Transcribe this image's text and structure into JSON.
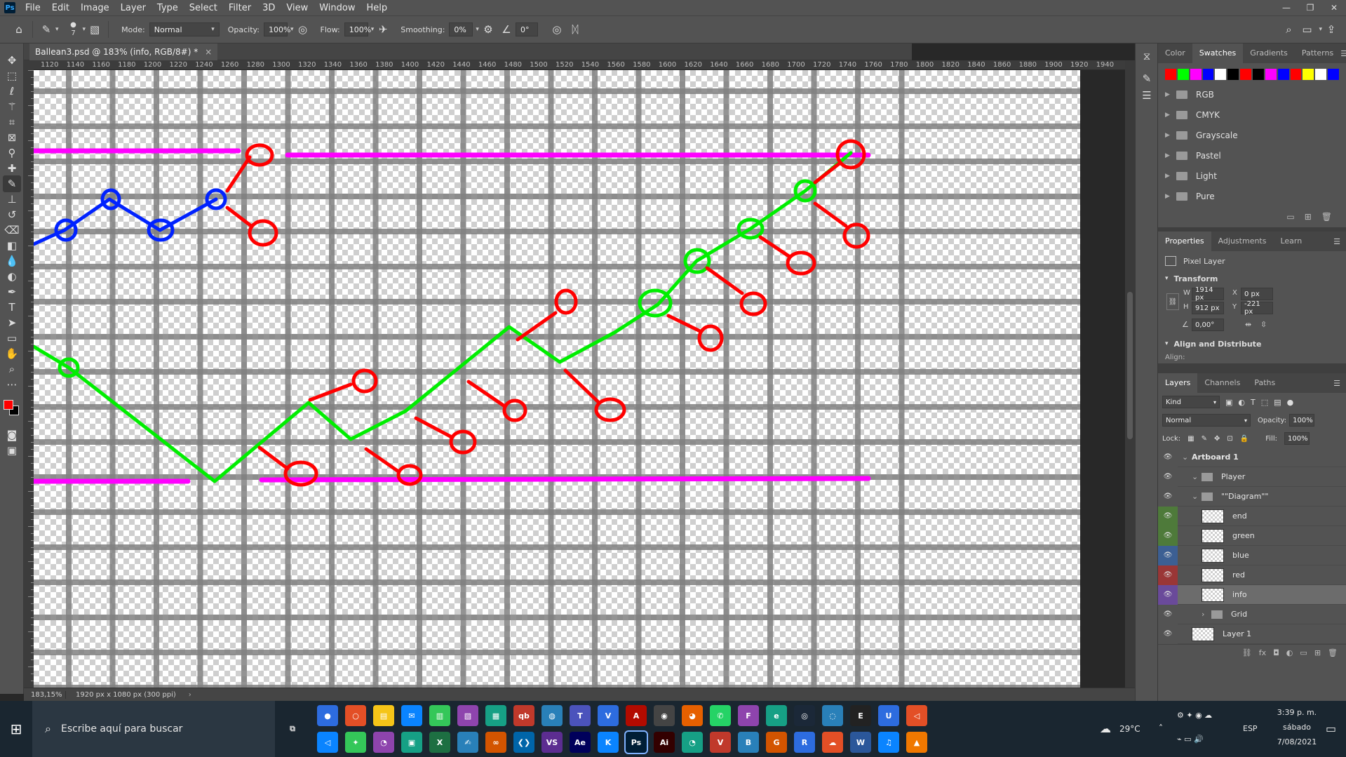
{
  "app": {
    "logo_text": "Ps"
  },
  "menu": [
    "File",
    "Edit",
    "Image",
    "Layer",
    "Type",
    "Select",
    "Filter",
    "3D",
    "View",
    "Window",
    "Help"
  ],
  "options": {
    "brush_size": "7",
    "mode_label": "Mode:",
    "mode_value": "Normal",
    "opacity_label": "Opacity:",
    "opacity_value": "100%",
    "flow_label": "Flow:",
    "flow_value": "100%",
    "smoothing_label": "Smoothing:",
    "smoothing_value": "0%",
    "angle_value": "0°"
  },
  "document": {
    "tab_title": "Ballean3.psd @ 183% (info, RGB/8#) *",
    "close_glyph": "×",
    "zoom": "183,15%",
    "doc_info": "1920 px x 1080 px (300 ppi)"
  },
  "ruler_top_labels": [
    "1120",
    "1140",
    "1160",
    "1180",
    "1200",
    "1220",
    "1240",
    "1260",
    "1280",
    "1300",
    "1320",
    "1340",
    "1360",
    "1380",
    "1400",
    "1420",
    "1440",
    "1460",
    "1480",
    "1500",
    "1520",
    "1540",
    "1560",
    "1580",
    "1600",
    "1620",
    "1640",
    "1660",
    "1680",
    "1700",
    "1720",
    "1740",
    "1760",
    "1780",
    "1800",
    "1820",
    "1840",
    "1860",
    "1880",
    "1900",
    "1920",
    "1940"
  ],
  "swatches_panel": {
    "tabs": [
      "Color",
      "Swatches",
      "Gradients",
      "Patterns"
    ],
    "active_tab": "Swatches",
    "colors": [
      "#ff0000",
      "#00ff00",
      "#ff00ff",
      "#0000ff",
      "#ffffff",
      "#000000",
      "#ff0000",
      "#000000",
      "#ff00ff",
      "#0000ff",
      "#ff0000",
      "#ffff00",
      "#ffffff",
      "#0000ff"
    ],
    "folders": [
      "RGB",
      "CMYK",
      "Grayscale",
      "Pastel",
      "Light",
      "Pure"
    ]
  },
  "properties_panel": {
    "tabs": [
      "Properties",
      "Adjustments",
      "Learn"
    ],
    "active_tab": "Properties",
    "kind": "Pixel Layer",
    "transform_label": "Transform",
    "w_label": "W",
    "w": "1914 px",
    "h_label": "H",
    "h": "912 px",
    "x_label": "X",
    "x": "0 px",
    "y_label": "Y",
    "y": "-221 px",
    "angle": "0,00°",
    "align_label": "Align and Distribute",
    "align_sub": "Align:"
  },
  "layers_panel": {
    "tabs": [
      "Layers",
      "Channels",
      "Paths"
    ],
    "active_tab": "Layers",
    "filter": "Kind",
    "blend": "Normal",
    "opacity_label": "Opacity:",
    "opacity": "100%",
    "lock_label": "Lock:",
    "fill_label": "Fill:",
    "fill": "100%",
    "layers": [
      {
        "name": "Artboard 1",
        "indent": 0,
        "type": "artboard",
        "eye_color": "#535353"
      },
      {
        "name": "Player",
        "indent": 1,
        "type": "group",
        "eye_color": "#535353"
      },
      {
        "name": "\"\"Diagram\"\"",
        "indent": 1,
        "type": "group",
        "eye_color": "#535353"
      },
      {
        "name": "end",
        "indent": 2,
        "type": "pixel",
        "eye_color": "#4e7a3a"
      },
      {
        "name": "green",
        "indent": 2,
        "type": "pixel",
        "eye_color": "#4e7a3a"
      },
      {
        "name": "blue",
        "indent": 2,
        "type": "pixel",
        "eye_color": "#3c5f93"
      },
      {
        "name": "red",
        "indent": 2,
        "type": "pixel",
        "eye_color": "#9a3636"
      },
      {
        "name": "info",
        "indent": 2,
        "type": "pixel",
        "eye_color": "#6a4a9a",
        "selected": true
      },
      {
        "name": "Grid",
        "indent": 2,
        "type": "group",
        "eye_color": "#535353"
      },
      {
        "name": "Layer 1",
        "indent": 1,
        "type": "pixel",
        "eye_color": "#535353"
      }
    ]
  },
  "taskbar": {
    "search_placeholder": "Escribe aquí para buscar",
    "weather": "29°C",
    "lang": "ESP",
    "time": "3:39 p. m.",
    "day": "sábado",
    "date": "7/08/2021",
    "apps_row1": [
      "obs",
      "cortana",
      "explorer",
      "mail",
      "notes",
      "photos",
      "calc",
      "qb",
      "chat",
      "teams",
      "voicemeeter",
      "acrobat",
      "chrome",
      "firefox",
      "whatsapp",
      "fl",
      "edge",
      "steam",
      "origin",
      "epic",
      "unreal",
      "unity"
    ],
    "apps_row2": [
      "unity2",
      "inkscape",
      "blender2",
      "store",
      "excel",
      "wacom",
      "arduino",
      "vscode",
      "vs",
      "ae",
      "krita",
      "ps",
      "ai",
      "blender",
      "vegas",
      "brave",
      "gamer",
      "rew",
      "cloud",
      "word",
      "spotify",
      "vlc"
    ]
  },
  "icons": {
    "home": "home-icon",
    "brush": "brush-icon",
    "search": "search-icon",
    "eye": "eye-icon"
  }
}
